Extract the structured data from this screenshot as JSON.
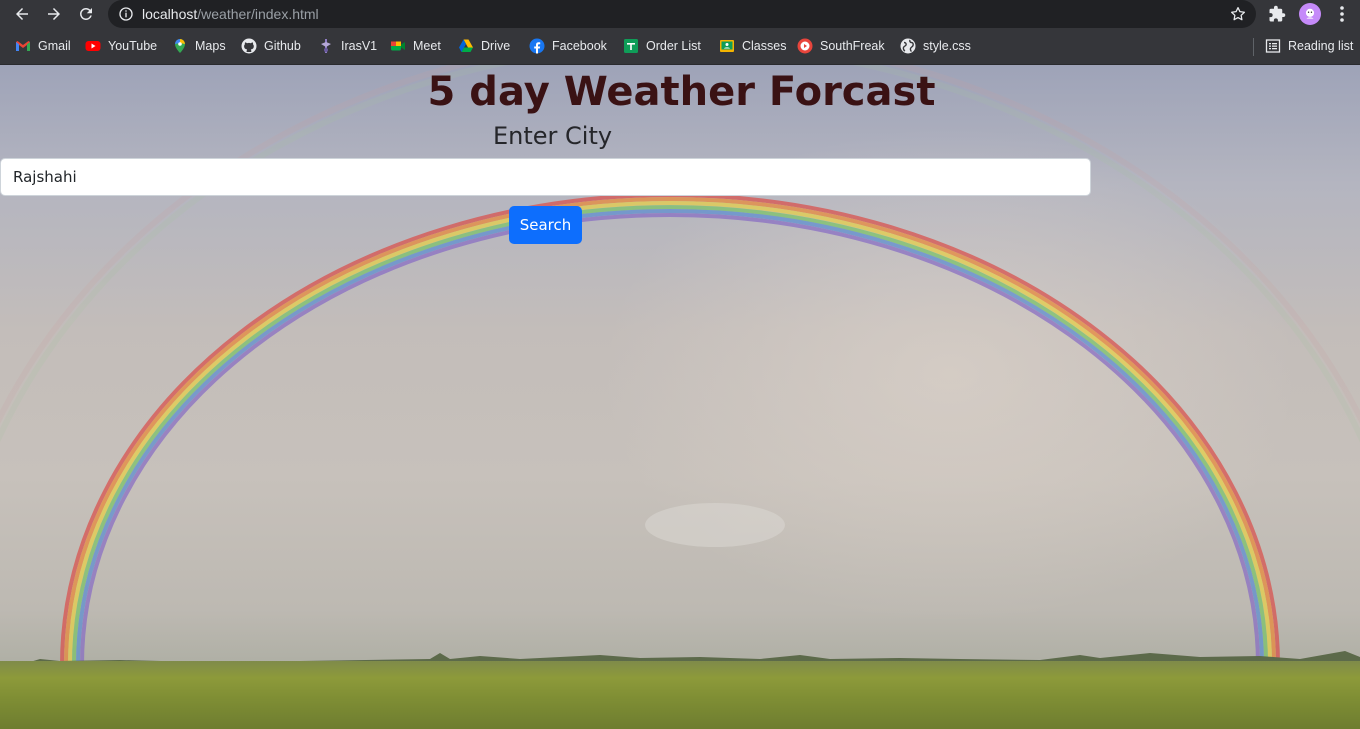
{
  "browser": {
    "url_host": "localhost",
    "url_path": "/weather/index.html",
    "bookmarks": [
      {
        "label": "Gmail",
        "icon": "gmail-icon"
      },
      {
        "label": "YouTube",
        "icon": "youtube-icon"
      },
      {
        "label": "Maps",
        "icon": "maps-icon"
      },
      {
        "label": "Github",
        "icon": "github-icon"
      },
      {
        "label": "IrasV1",
        "icon": "iras-icon"
      },
      {
        "label": "Meet",
        "icon": "meet-icon"
      },
      {
        "label": "Drive",
        "icon": "drive-icon"
      },
      {
        "label": "Facebook",
        "icon": "facebook-icon"
      },
      {
        "label": "Order List",
        "icon": "sheets-icon"
      },
      {
        "label": "Classes",
        "icon": "classroom-icon"
      },
      {
        "label": "SouthFreak",
        "icon": "southfreak-icon"
      },
      {
        "label": "style.css",
        "icon": "globe-icon"
      }
    ],
    "reading_list": "Reading list"
  },
  "page": {
    "title": "5 day Weather Forcast",
    "city_label": "Enter City",
    "city_value": "Rajshahi",
    "search_label": "Search",
    "colors": {
      "title": "#3a1214",
      "button": "#0d6efd"
    }
  }
}
